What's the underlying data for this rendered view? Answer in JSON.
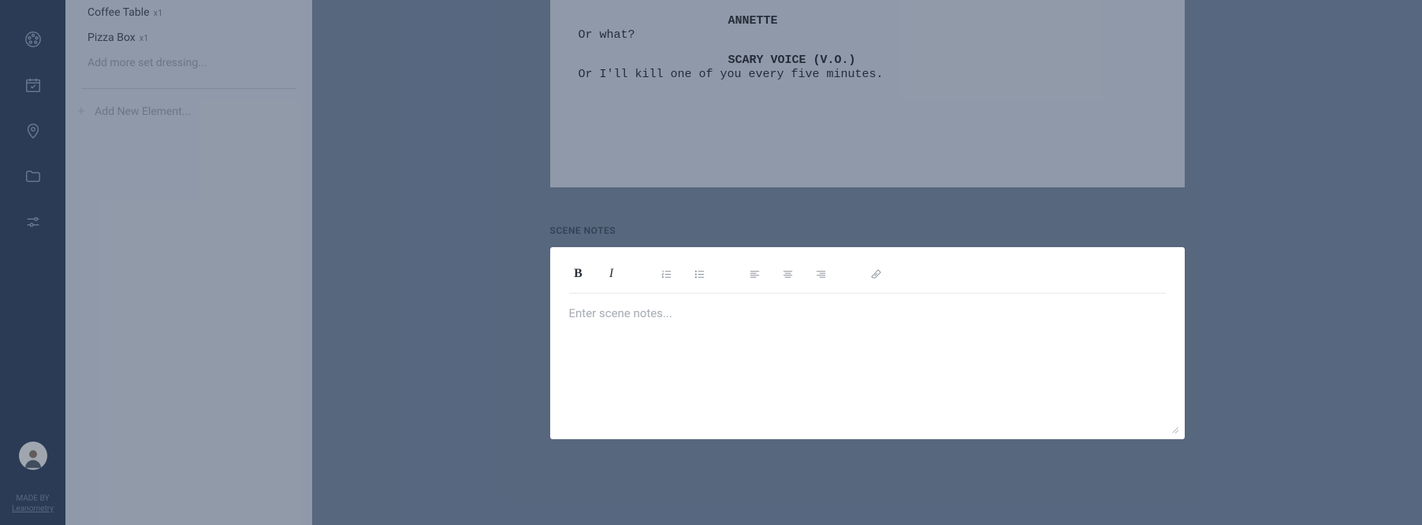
{
  "nav": {
    "made_by_label": "MADE BY",
    "made_by_brand": "Leanometry"
  },
  "sidebar": {
    "items": [
      {
        "label": "Coffee Table",
        "qty": "x1"
      },
      {
        "label": "Pizza Box",
        "qty": "x1"
      }
    ],
    "add_more_placeholder": "Add more set dressing...",
    "add_new_label": "Add New Element..."
  },
  "script": {
    "blocks": [
      {
        "character": "ANNETTE",
        "dialogue": "Or what?"
      },
      {
        "character": "SCARY VOICE (V.O.)",
        "dialogue": "Or I'll kill one of you every five minutes."
      }
    ]
  },
  "notes": {
    "section_label": "SCENE NOTES",
    "placeholder": "Enter scene notes..."
  }
}
